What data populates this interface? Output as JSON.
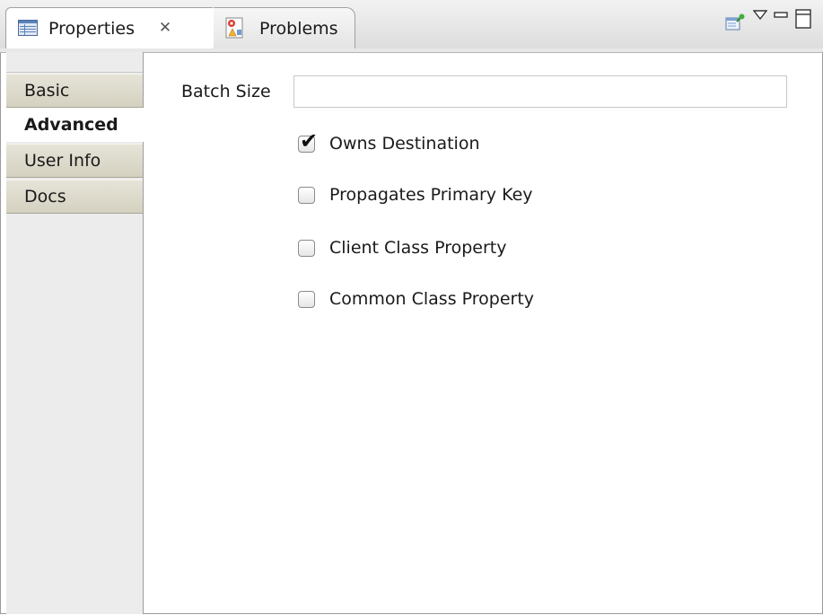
{
  "tabs": [
    {
      "label": "Properties",
      "icon": "properties-table-icon",
      "active": true
    },
    {
      "label": "Problems",
      "icon": "problems-icon",
      "active": false
    }
  ],
  "toolbar": {
    "pin_icon": "pin-editor-icon",
    "menu_icon": "view-menu-icon",
    "minimize_icon": "minimize-icon",
    "maximize_icon": "maximize-icon"
  },
  "sidebar": {
    "items": [
      {
        "label": "Basic",
        "selected": false
      },
      {
        "label": "Advanced",
        "selected": true
      },
      {
        "label": "User Info",
        "selected": false
      },
      {
        "label": "Docs",
        "selected": false
      }
    ]
  },
  "form": {
    "batch_size_label": "Batch Size",
    "batch_size_value": "",
    "checkboxes": [
      {
        "label": "Owns Destination",
        "checked": true
      },
      {
        "label": "Propagates Primary Key",
        "checked": false
      },
      {
        "label": "Client Class Property",
        "checked": false
      },
      {
        "label": "Common Class Property",
        "checked": false
      }
    ]
  },
  "colors": {
    "side_tab_bg": "#dcd9ca",
    "border": "#a0a0a0",
    "checkmark": "#111111"
  }
}
